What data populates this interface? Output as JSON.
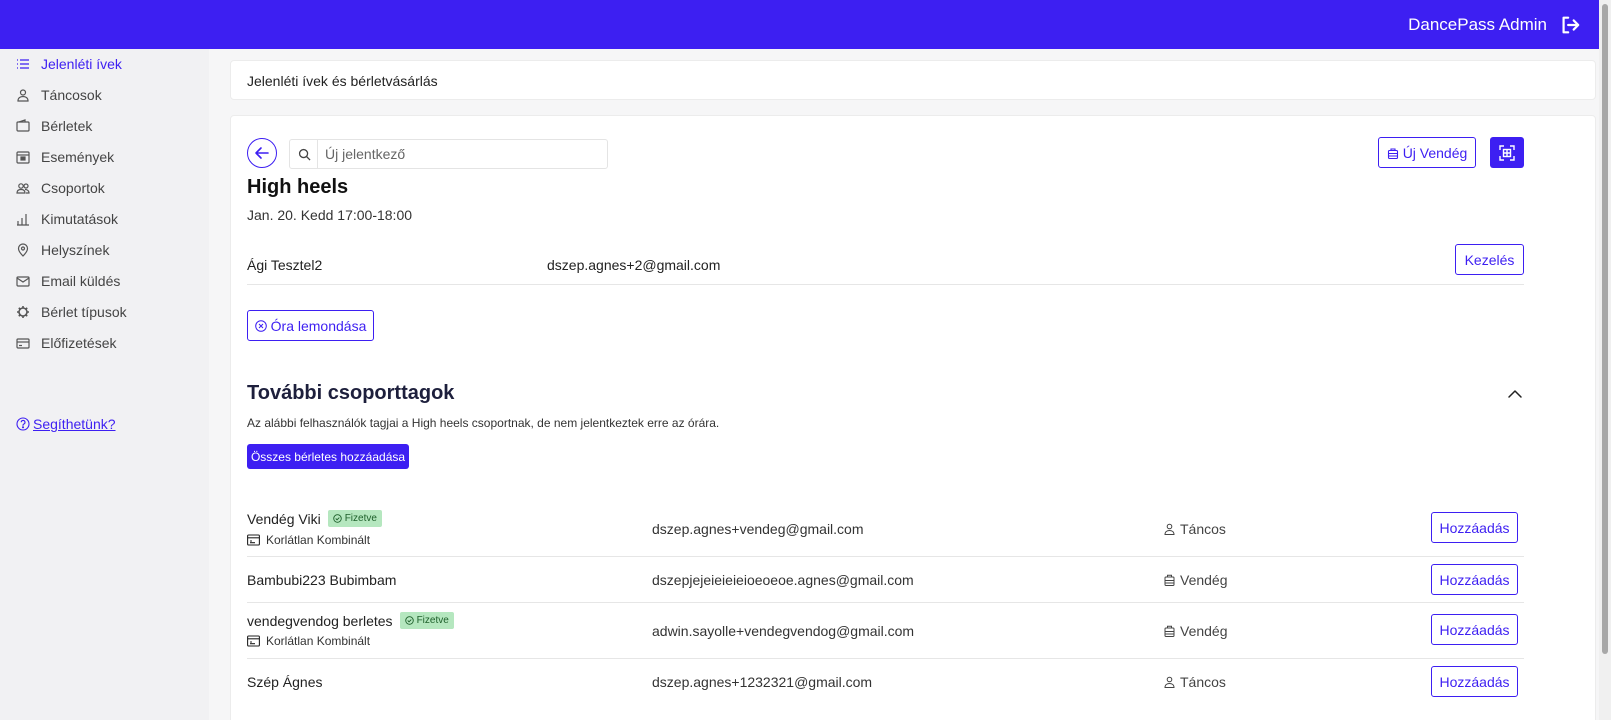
{
  "header": {
    "app_title": "DancePass Admin"
  },
  "sidebar": {
    "items": [
      {
        "label": "Jelenléti ívek",
        "icon": "list-icon"
      },
      {
        "label": "Táncosok",
        "icon": "user-icon"
      },
      {
        "label": "Bérletek",
        "icon": "wallet-icon"
      },
      {
        "label": "Események",
        "icon": "calendar-event-icon"
      },
      {
        "label": "Csoportok",
        "icon": "users-icon"
      },
      {
        "label": "Kimutatások",
        "icon": "bar-chart-icon"
      },
      {
        "label": "Helyszínek",
        "icon": "map-pin-icon"
      },
      {
        "label": "Email küldés",
        "icon": "mail-icon"
      },
      {
        "label": "Bérlet típusok",
        "icon": "gear-icon"
      },
      {
        "label": "Előfizetések",
        "icon": "credit-card-icon"
      }
    ],
    "help_label": "Segíthetünk?"
  },
  "breadcrumb": {
    "title": "Jelenléti ívek és bérletvásárlás"
  },
  "search": {
    "placeholder": "Új jelentkező",
    "value": ""
  },
  "toolbar": {
    "new_guest_label": "Új Vendég"
  },
  "class_info": {
    "title": "High heels",
    "time": "Jan. 20. Kedd 17:00-18:00"
  },
  "attendees": [
    {
      "name": "Ági Tesztel2",
      "email": "dszep.agnes+2@gmail.com",
      "action": "Kezelés"
    }
  ],
  "cancel_label": "Óra lemondása",
  "more_members": {
    "title": "További csoporttagok",
    "description": "Az alábbi felhasználók tagjai a High heels csoportnak, de nem jelentkeztek erre az órára.",
    "add_all_label": "Összes bérletes hozzáadása",
    "rows": [
      {
        "name": "Vendég Viki",
        "badge": "Fizetve",
        "pass": "Korlátlan Kombinált",
        "email": "dszep.agnes+vendeg@gmail.com",
        "role": "Táncos",
        "action": "Hozzáadás"
      },
      {
        "name": "Bambubi223 Bubimbam",
        "badge": "",
        "pass": "",
        "email": "dszepjejeieieieioeoeoe.agnes@gmail.com",
        "role": "Vendég",
        "action": "Hozzáadás"
      },
      {
        "name": "vendegvendog berletes",
        "badge": "Fizetve",
        "pass": "Korlátlan Kombinált",
        "email": "adwin.sayolle+vendegvendog@gmail.com",
        "role": "Vendég",
        "action": "Hozzáadás"
      },
      {
        "name": "Szép Ágnes",
        "badge": "",
        "pass": "",
        "email": "dszep.agnes+1232321@gmail.com",
        "role": "Táncos",
        "action": "Hozzáadás"
      }
    ]
  },
  "colors": {
    "brand": "#3d1ff2",
    "badge_bg": "#b5e7bf",
    "badge_text": "#1d5f2a",
    "sidebar_bg": "#f1f1f3"
  }
}
